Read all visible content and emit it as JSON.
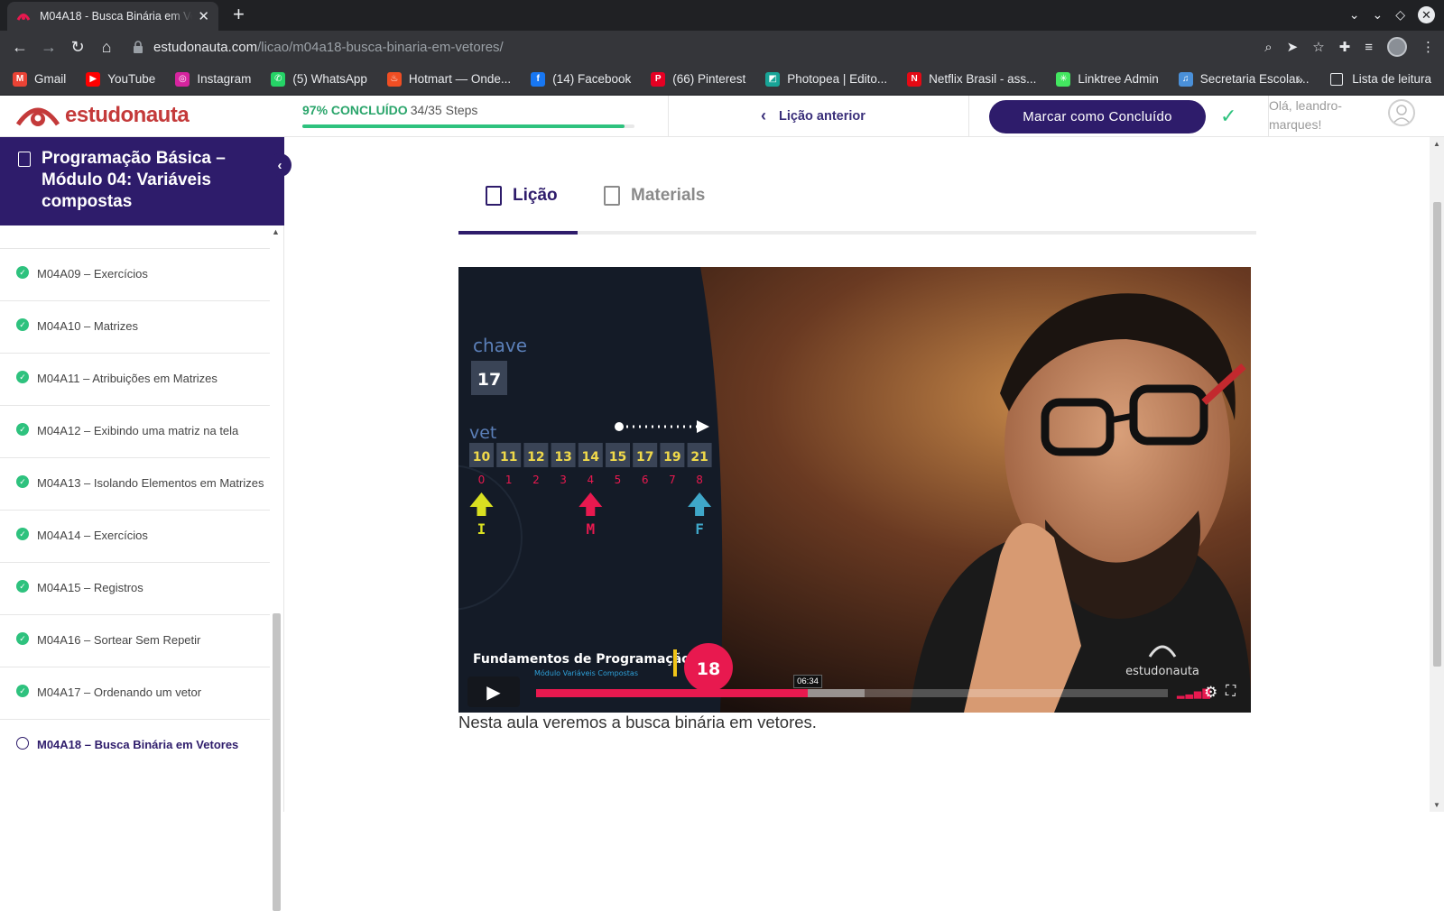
{
  "browser": {
    "tab_title": "M04A18 - Busca Binária em Vetores",
    "tab_close": "✕",
    "new_tab": "+",
    "url_host": "estudonauta.com",
    "url_path": "/licao/m04a18-busca-binaria-em-vetores/",
    "bookmarks": [
      {
        "label": "Gmail",
        "color": "#ea4335",
        "glyph": "M"
      },
      {
        "label": "YouTube",
        "color": "#ff0000",
        "glyph": "▶"
      },
      {
        "label": "Instagram",
        "color": "#d6249f",
        "glyph": "◎"
      },
      {
        "label": "(5) WhatsApp",
        "color": "#25d366",
        "glyph": "✆"
      },
      {
        "label": "Hotmart — Onde...",
        "color": "#f04e23",
        "glyph": "♨"
      },
      {
        "label": "(14) Facebook",
        "color": "#1877f2",
        "glyph": "f"
      },
      {
        "label": "(66) Pinterest",
        "color": "#e60023",
        "glyph": "P"
      },
      {
        "label": "Photopea | Edito...",
        "color": "#18a497",
        "glyph": "◩"
      },
      {
        "label": "Netflix Brasil - ass...",
        "color": "#e50914",
        "glyph": "N"
      },
      {
        "label": "Linktree Admin",
        "color": "#43e660",
        "glyph": "✳"
      },
      {
        "label": "Secretaria Escolar...",
        "color": "#4a90d9",
        "glyph": "♫"
      }
    ],
    "bookmarks_more": "»",
    "reading_list": "Lista de leitura"
  },
  "header": {
    "logo_text": "estudonauta",
    "progress_percent_label": "97% CONCLUÍDO",
    "progress_steps": "34/35 Steps",
    "progress_fraction": 0.97,
    "prev_lesson": "Lição anterior",
    "mark_complete": "Marcar como Concluído",
    "greeting": "Olá, leandro-marques!"
  },
  "sidebar": {
    "course_title": "Programação Básica – Módulo 04: Variáveis compostas",
    "lessons": [
      {
        "label": "M04A09 – Exercícios",
        "done": true
      },
      {
        "label": "M04A10 – Matrizes",
        "done": true
      },
      {
        "label": "M04A11 – Atribuições em Matrizes",
        "done": true
      },
      {
        "label": "M04A12 – Exibindo uma matriz na tela",
        "done": true
      },
      {
        "label": "M04A13 – Isolando Elementos em Matrizes",
        "done": true
      },
      {
        "label": "M04A14 – Exercícios",
        "done": true
      },
      {
        "label": "M04A15 – Registros",
        "done": true
      },
      {
        "label": "M04A16 – Sortear Sem Repetir",
        "done": true
      },
      {
        "label": "M04A17 – Ordenando um vetor",
        "done": true
      },
      {
        "label": "M04A18 – Busca Binária em Vetores",
        "done": false,
        "current": true
      }
    ]
  },
  "main": {
    "tab_lesson": "Lição",
    "tab_materials": "Materials",
    "video": {
      "key_label": "chave",
      "key_value": "17",
      "vet_label": "vet",
      "values": [
        "10",
        "11",
        "12",
        "13",
        "14",
        "15",
        "17",
        "19",
        "21"
      ],
      "indices": [
        "0",
        "1",
        "2",
        "3",
        "4",
        "5",
        "6",
        "7",
        "8"
      ],
      "pointer_labels": [
        "I",
        "M",
        "F"
      ],
      "footer_title": "Fundamentos de Programação",
      "footer_subtitle": "Módulo Variáveis Compostas",
      "episode": "18",
      "watermark": "estudonauta",
      "time_tooltip": "06:34",
      "played_fraction": 0.43,
      "buffered_fraction": 0.52
    },
    "description": "Nesta aula veremos a busca binária em vetores."
  }
}
